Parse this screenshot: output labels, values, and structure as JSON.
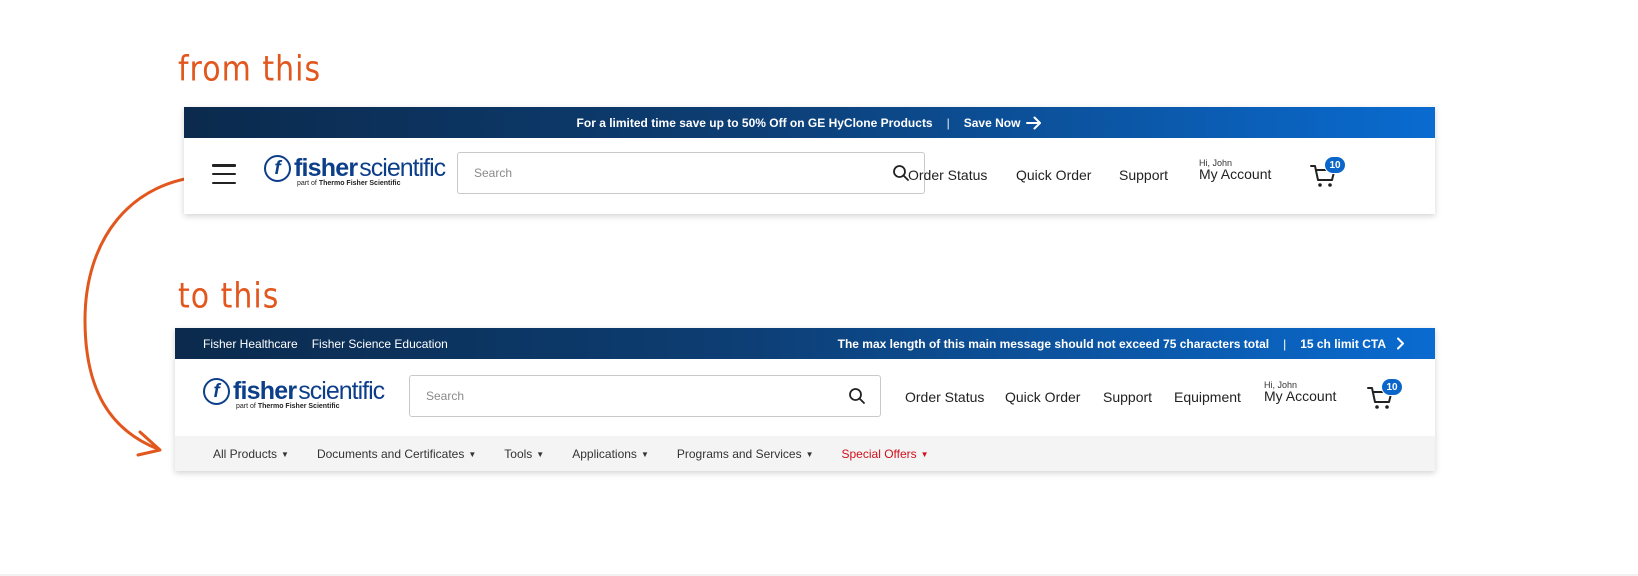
{
  "annotations": {
    "from": "from this",
    "to": "to this"
  },
  "colors": {
    "accent": "#e2571d",
    "brand_navy": "#0d3e8a",
    "badge_blue": "#0b66c9",
    "special_red": "#d0101b"
  },
  "before": {
    "promo": {
      "message": "For a limited time save up to 50% Off on GE HyClone Products",
      "separator": "|",
      "cta": "Save Now"
    },
    "menu_icon": "hamburger-icon",
    "logo": {
      "bold": "fisher",
      "light": "scientific",
      "tagline_prefix": "part of",
      "tagline_brand": "Thermo Fisher Scientific"
    },
    "search": {
      "placeholder": "Search"
    },
    "nav": [
      "Order Status",
      "Quick Order",
      "Support"
    ],
    "account": {
      "greeting": "Hi, John",
      "label": "My Account"
    },
    "cart": {
      "count": "10"
    }
  },
  "after": {
    "utility_links": [
      "Fisher Healthcare",
      "Fisher Science Education"
    ],
    "promo": {
      "message": "The max length of this main message should not exceed 75 characters total",
      "separator": "|",
      "cta": "15 ch limit CTA"
    },
    "logo": {
      "bold": "fisher",
      "light": "scientific",
      "tagline_prefix": "part of",
      "tagline_brand": "Thermo Fisher Scientific"
    },
    "search": {
      "placeholder": "Search"
    },
    "nav": [
      "Order Status",
      "Quick Order",
      "Support",
      "Equipment"
    ],
    "account": {
      "greeting": "Hi, John",
      "label": "My Account"
    },
    "cart": {
      "count": "10"
    },
    "categories": [
      "All Products",
      "Documents and Certificates",
      "Tools",
      "Applications",
      "Programs and Services",
      "Special Offers"
    ]
  }
}
